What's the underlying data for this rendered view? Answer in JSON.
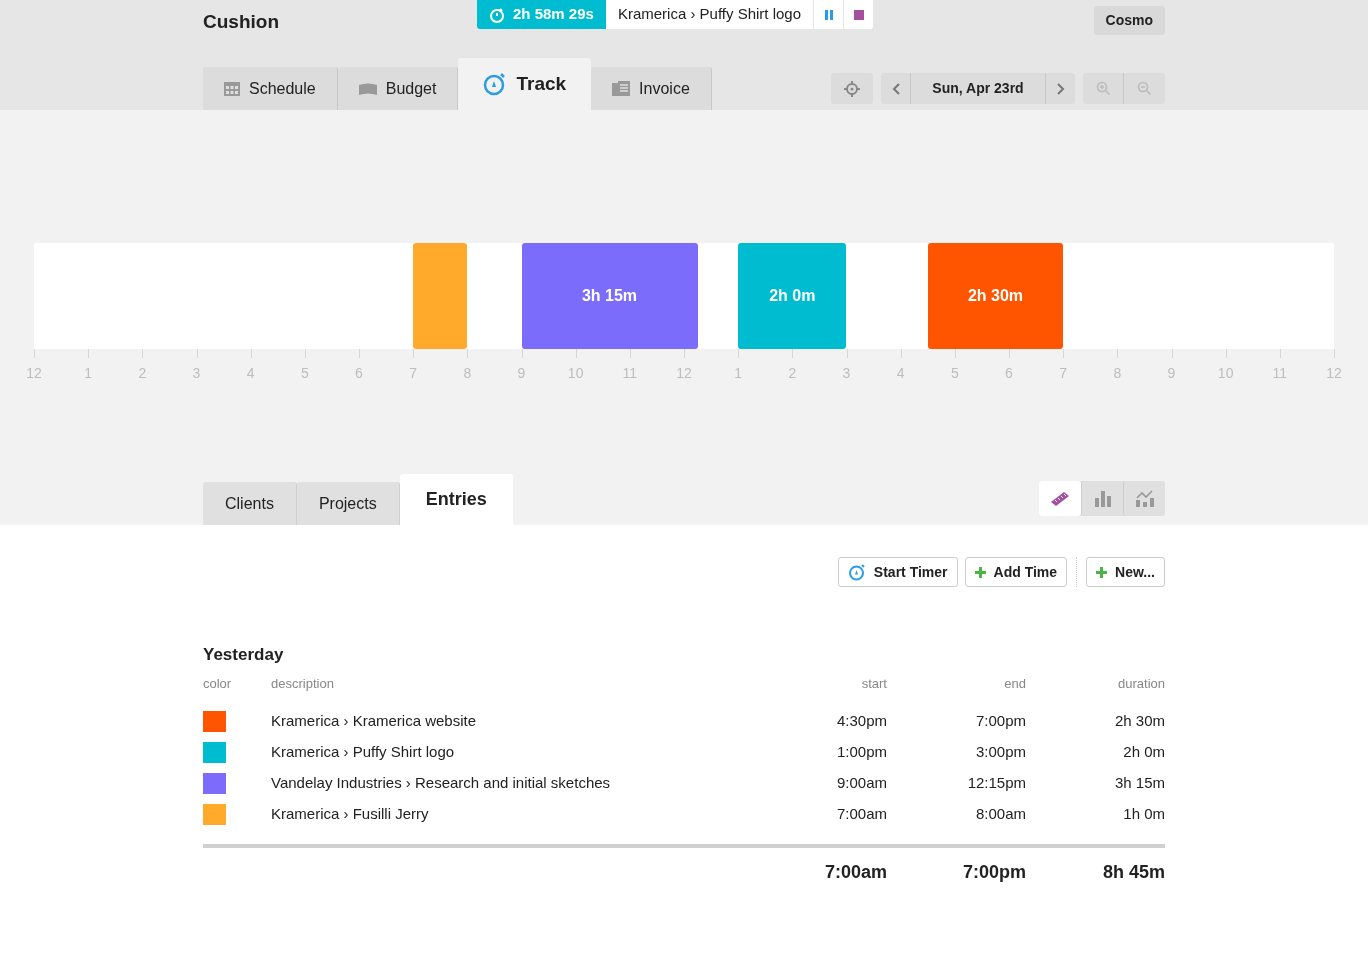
{
  "app": {
    "title": "Cushion",
    "user": "Cosmo"
  },
  "timer": {
    "elapsed": "2h 58m 29s",
    "task": "Kramerica › Puffy Shirt logo"
  },
  "main_tabs": [
    {
      "label": "Schedule",
      "selected": false
    },
    {
      "label": "Budget",
      "selected": false
    },
    {
      "label": "Track",
      "selected": true
    },
    {
      "label": "Invoice",
      "selected": false
    }
  ],
  "date_nav": {
    "date": "Sun, Apr 23rd"
  },
  "timeline": {
    "blocks": [
      {
        "color": "#ffaa2a"
      },
      {
        "color": "#7b6cfc",
        "label": "3h 15m"
      },
      {
        "color": "#00bcd0",
        "label": "2h 0m"
      },
      {
        "color": "#ff5500",
        "label": "2h 30m"
      }
    ],
    "hour_labels": [
      "12",
      "1",
      "2",
      "3",
      "4",
      "5",
      "6",
      "7",
      "8",
      "9",
      "10",
      "11",
      "12",
      "1",
      "2",
      "3",
      "4",
      "5",
      "6",
      "7",
      "8",
      "9",
      "10",
      "11",
      "12"
    ]
  },
  "sub_tabs": [
    {
      "label": "Clients",
      "selected": false
    },
    {
      "label": "Projects",
      "selected": false
    },
    {
      "label": "Entries",
      "selected": true
    }
  ],
  "view_toggles": [
    {
      "selected": true
    },
    {
      "selected": false
    },
    {
      "selected": false
    }
  ],
  "actions": [
    {
      "label": "Start Timer"
    },
    {
      "label": "Add Time"
    },
    {
      "label": "New..."
    }
  ],
  "section": {
    "title": "Yesterday",
    "columns": [
      "color",
      "description",
      "start",
      "end",
      "duration"
    ],
    "entries": [
      {
        "color": "#ff5500",
        "description": "Kramerica › Kramerica website",
        "start": "4:30pm",
        "end": "7:00pm",
        "duration": "2h 30m"
      },
      {
        "color": "#00bcd0",
        "description": "Kramerica › Puffy Shirt logo",
        "start": "1:00pm",
        "end": "3:00pm",
        "duration": "2h 0m"
      },
      {
        "color": "#7b6cfc",
        "description": "Vandelay Industries › Research and initial sketches",
        "start": "9:00am",
        "end": "12:15pm",
        "duration": "3h 15m"
      },
      {
        "color": "#ffaa2a",
        "description": "Kramerica › Fusilli Jerry",
        "start": "7:00am",
        "end": "8:00am",
        "duration": "1h 0m"
      }
    ],
    "totals": {
      "start": "7:00am",
      "end": "7:00pm",
      "duration": "8h 45m"
    }
  }
}
